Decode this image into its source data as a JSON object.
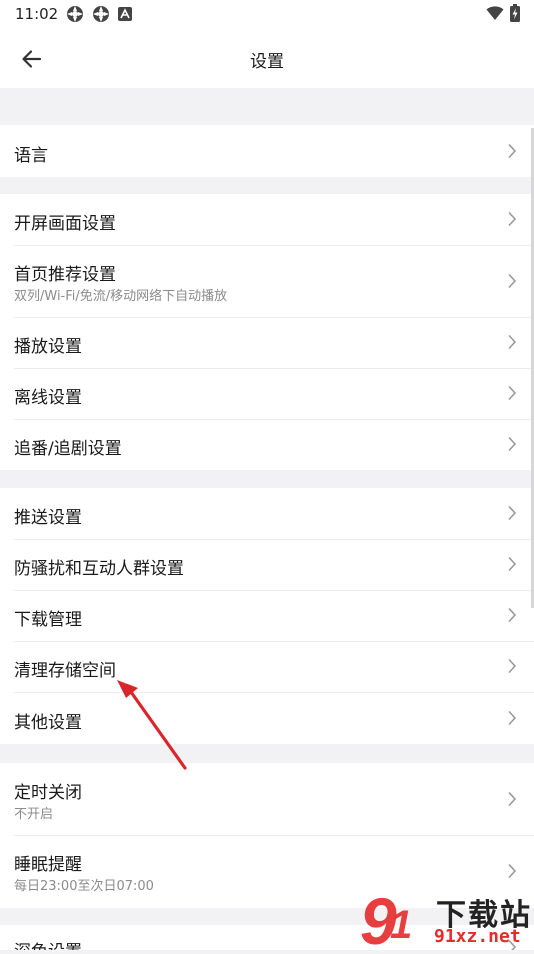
{
  "status_bar": {
    "time": "11:02"
  },
  "header": {
    "title": "设置"
  },
  "groups": [
    {
      "items": [
        {
          "label": "语言"
        }
      ]
    },
    {
      "items": [
        {
          "label": "开屏画面设置"
        },
        {
          "label": "首页推荐设置",
          "sub": "双列/Wi-Fi/免流/移动网络下自动播放"
        },
        {
          "label": "播放设置"
        },
        {
          "label": "离线设置"
        },
        {
          "label": "追番/追剧设置"
        }
      ]
    },
    {
      "items": [
        {
          "label": "推送设置"
        },
        {
          "label": "防骚扰和互动人群设置"
        },
        {
          "label": "下载管理"
        },
        {
          "label": "清理存储空间"
        },
        {
          "label": "其他设置"
        }
      ]
    },
    {
      "items": [
        {
          "label": "定时关闭",
          "sub": "不开启"
        },
        {
          "label": "睡眠提醒",
          "sub": "每日23:00至次日07:00"
        }
      ]
    },
    {
      "items": [
        {
          "label": "深色设置"
        }
      ]
    }
  ],
  "watermark": {
    "brand": "下载站",
    "domain": "91xz.net"
  },
  "colors": {
    "annotation_arrow": "#d9262b",
    "watermark": "#e52b2b"
  }
}
